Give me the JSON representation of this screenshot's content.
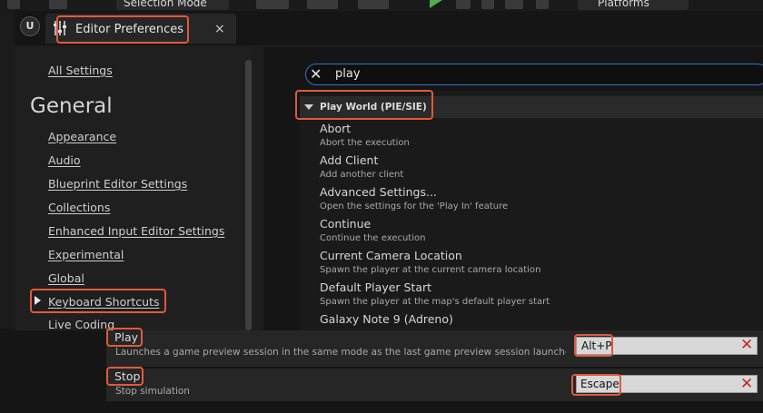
{
  "toolbar": {
    "selection_mode": "Selection Mode",
    "platforms": "Platforms"
  },
  "window": {
    "tab_title": "Editor Preferences",
    "close_symbol": "×"
  },
  "sidebar": {
    "all_settings": "All Settings",
    "section_title": "General",
    "items": [
      {
        "label": "Appearance"
      },
      {
        "label": "Audio"
      },
      {
        "label": "Blueprint Editor Settings"
      },
      {
        "label": "Collections"
      },
      {
        "label": "Enhanced Input Editor Settings"
      },
      {
        "label": "Experimental"
      },
      {
        "label": "Global"
      },
      {
        "label": "Keyboard Shortcuts"
      },
      {
        "label": "Live Coding"
      }
    ]
  },
  "search": {
    "value": "play",
    "clear_symbol": "✕"
  },
  "category": {
    "label": "Play World (PIE/SIE)"
  },
  "commands": [
    {
      "title": "Abort",
      "desc": "Abort the execution"
    },
    {
      "title": "Add Client",
      "desc": "Add another client"
    },
    {
      "title": "Advanced Settings...",
      "desc": "Open the settings for the 'Play In' feature"
    },
    {
      "title": "Continue",
      "desc": "Continue the execution"
    },
    {
      "title": "Current Camera Location",
      "desc": "Spawn the player at the current camera location"
    },
    {
      "title": "Default Player Start",
      "desc": "Spawn the player at the map's default player start"
    },
    {
      "title": "Galaxy Note 9 (Adreno)",
      "desc": ""
    }
  ],
  "shortcuts": [
    {
      "title": "Play",
      "desc": "Launches a game preview session in the same mode as the last game preview session launched fr",
      "key": "Alt+P"
    },
    {
      "title": "Stop",
      "desc": "Stop simulation",
      "key": "Escape"
    }
  ],
  "colors": {
    "highlight": "#e05a3a",
    "search_border": "#2f74c8",
    "clear_key": "#c62828"
  }
}
